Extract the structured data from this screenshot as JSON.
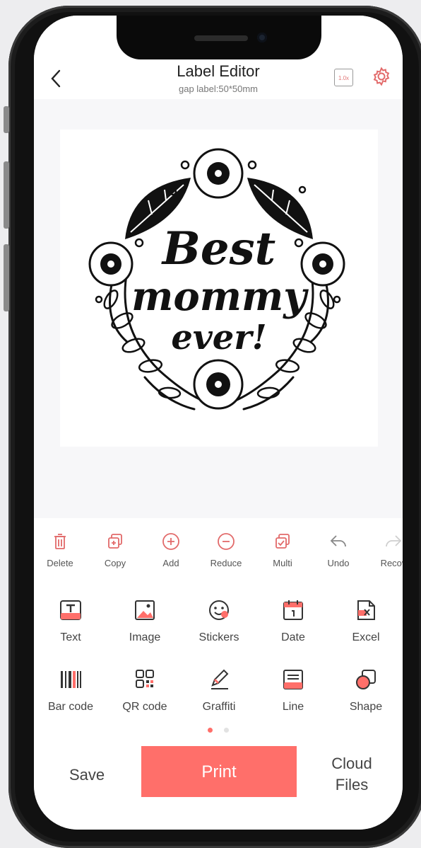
{
  "header": {
    "title": "Label Editor",
    "subtitle": "gap label:50*50mm",
    "zoom_badge": "1.0x",
    "back_glyph": "‹"
  },
  "canvas": {
    "artwork_text": [
      "Best",
      "mommy",
      "ever!"
    ]
  },
  "toolbar": {
    "items": [
      {
        "label": "Delete",
        "icon": "trash-icon"
      },
      {
        "label": "Copy",
        "icon": "copy-icon"
      },
      {
        "label": "Add",
        "icon": "plus-circle-icon"
      },
      {
        "label": "Reduce",
        "icon": "minus-circle-icon"
      },
      {
        "label": "Multi",
        "icon": "multi-select-icon"
      },
      {
        "label": "Undo",
        "icon": "undo-icon"
      },
      {
        "label": "Recov",
        "icon": "redo-icon"
      }
    ]
  },
  "elements": {
    "items": [
      {
        "label": "Text",
        "icon": "text-icon"
      },
      {
        "label": "Image",
        "icon": "image-icon"
      },
      {
        "label": "Stickers",
        "icon": "sticker-icon"
      },
      {
        "label": "Date",
        "icon": "calendar-icon"
      },
      {
        "label": "Excel",
        "icon": "excel-icon"
      },
      {
        "label": "Bar code",
        "icon": "barcode-icon"
      },
      {
        "label": "QR code",
        "icon": "qr-code-icon"
      },
      {
        "label": "Graffiti",
        "icon": "pen-icon"
      },
      {
        "label": "Line",
        "icon": "line-icon"
      },
      {
        "label": "Shape",
        "icon": "shape-icon"
      }
    ]
  },
  "pager": {
    "pages": 2,
    "active": 1
  },
  "actions": {
    "save_label": "Save",
    "print_label": "Print",
    "cloud_label_line1": "Cloud",
    "cloud_label_line2": "Files"
  },
  "colors": {
    "accent": "#ff6f6a",
    "icon_dark": "#333333",
    "muted": "#9a9a9a"
  }
}
